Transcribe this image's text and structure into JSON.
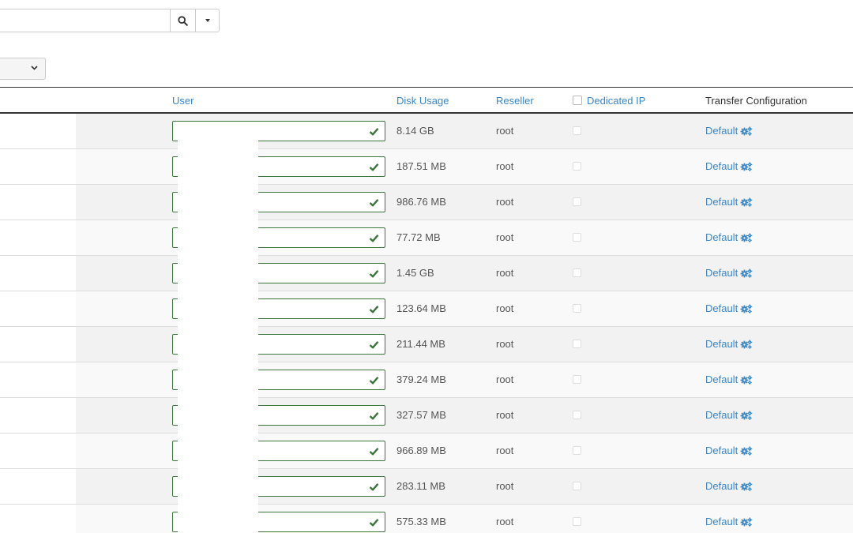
{
  "search": {
    "value": "",
    "placeholder": "",
    "icon": "search-icon",
    "dropdown_icon": "caret-down-icon"
  },
  "filter_select": {
    "selected": ""
  },
  "table": {
    "headers": {
      "user": "User",
      "disk_usage": "Disk Usage",
      "reseller": "Reseller",
      "dedicated_ip": "Dedicated IP",
      "transfer_configuration": "Transfer Configuration"
    },
    "rows": [
      {
        "disk_usage": "8.14 GB",
        "reseller": "root",
        "config": "Default"
      },
      {
        "disk_usage": "187.51 MB",
        "reseller": "root",
        "config": "Default"
      },
      {
        "disk_usage": "986.76 MB",
        "reseller": "root",
        "config": "Default"
      },
      {
        "disk_usage": "77.72 MB",
        "reseller": "root",
        "config": "Default"
      },
      {
        "disk_usage": "1.45 GB",
        "reseller": "root",
        "config": "Default"
      },
      {
        "disk_usage": "123.64 MB",
        "reseller": "root",
        "config": "Default"
      },
      {
        "disk_usage": "211.44 MB",
        "reseller": "root",
        "config": "Default"
      },
      {
        "disk_usage": "379.24 MB",
        "reseller": "root",
        "config": "Default"
      },
      {
        "disk_usage": "327.57 MB",
        "reseller": "root",
        "config": "Default"
      },
      {
        "disk_usage": "966.89 MB",
        "reseller": "root",
        "config": "Default"
      },
      {
        "disk_usage": "283.11 MB",
        "reseller": "root",
        "config": "Default"
      },
      {
        "disk_usage": "575.33 MB",
        "reseller": "root",
        "config": "Default"
      }
    ]
  },
  "colors": {
    "link": "#3a87c8",
    "valid_border": "#3c763d",
    "check_mark": "#3c763d"
  }
}
